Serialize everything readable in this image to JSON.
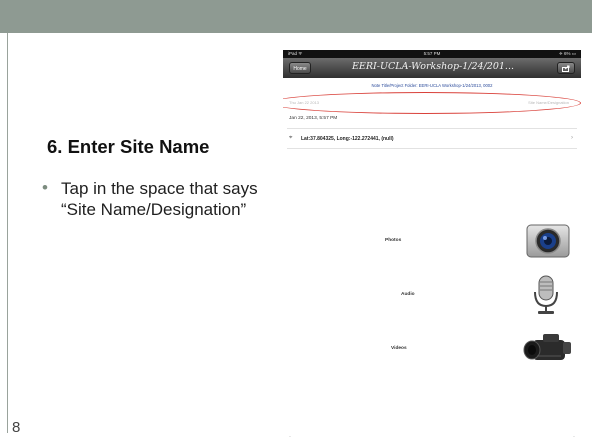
{
  "slide": {
    "heading": "6. Enter Site Name",
    "bullet": "Tap in the space that says “Site Name/Designation”",
    "bullet_marker": "•",
    "number": "8"
  },
  "ipad": {
    "status_left": "iPad ᯤ",
    "status_time": "5:57 PM",
    "status_right": "✈ 6% ▭",
    "nav_back": "Home",
    "nav_title": "EERI-UCLA-Workshop-1/24/201...",
    "folder_line": "Note Title/Project Folder: EERI-UCLA Workshop-1/24/2013, 0002",
    "site_date_hint": "Thu Jan 22 2013",
    "site_placeholder": "Site Name/Designation",
    "date_row": "Jan 22, 2013, 5:57 PM",
    "pin": "⌖",
    "coords": "Lat:37.804325, Long:-122.272441, (null)",
    "chevron": "›",
    "media": [
      {
        "label": "Photos",
        "icon": "camera-icon"
      },
      {
        "label": "Audio",
        "icon": "microphone-icon"
      },
      {
        "label": "Videos",
        "icon": "camcorder-icon"
      }
    ],
    "bottom_marks": [
      "·",
      "·"
    ]
  },
  "colors": {
    "top_band": "#8e9a92",
    "highlight": "#d9413a",
    "bullet_marker": "#7c8c7f"
  }
}
